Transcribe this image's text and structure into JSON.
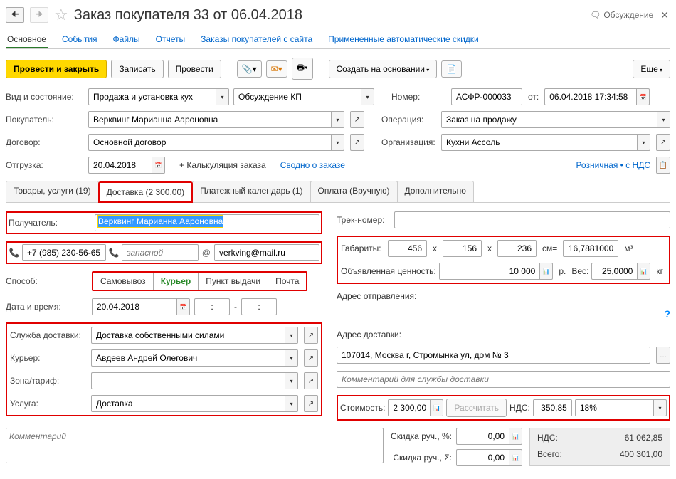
{
  "header": {
    "title": "Заказ покупателя 33 от 06.04.2018",
    "discussion": "Обсуждение"
  },
  "nav": {
    "main": "Основное",
    "events": "События",
    "files": "Файлы",
    "reports": "Отчеты",
    "site_orders": "Заказы покупателей с сайта",
    "auto_discounts": "Примененные автоматические скидки"
  },
  "toolbar": {
    "post_close": "Провести и закрыть",
    "write": "Записать",
    "post": "Провести",
    "create_based": "Создать на основании",
    "more": "Еще"
  },
  "main_form": {
    "kind_label": "Вид и состояние:",
    "kind_value": "Продажа и установка кух",
    "state_value": "Обсуждение КП",
    "number_label": "Номер:",
    "number_value": "АСФР-000033",
    "from_label": "от:",
    "date_value": "06.04.2018 17:34:58",
    "buyer_label": "Покупатель:",
    "buyer_value": "Верквинг Марианна Аароновна",
    "operation_label": "Операция:",
    "operation_value": "Заказ на продажу",
    "contract_label": "Договор:",
    "contract_value": "Основной договор",
    "org_label": "Организация:",
    "org_value": "Кухни Ассоль",
    "shipment_label": "Отгрузка:",
    "shipment_value": "20.04.2018",
    "calc_label": "+ Калькуляция заказа",
    "summary_link": "Сводно о заказе",
    "retail_vat": "Розничная • с НДС"
  },
  "doc_tabs": {
    "goods": "Товары, услуги (19)",
    "delivery": "Доставка (2 300,00)",
    "payment_cal": "Платежный календарь (1)",
    "payment": "Оплата (Вручную)",
    "extra": "Дополнительно"
  },
  "delivery": {
    "recipient_label": "Получатель:",
    "recipient_value": "Верквинг Марианна Аароновна",
    "phone1": "+7 (985) 230-56-65",
    "phone2_ph": "запасной",
    "email": "verkving@mail.ru",
    "method_label": "Способ:",
    "seg_pickup": "Самовывоз",
    "seg_courier": "Курьер",
    "seg_point": "Пункт выдачи",
    "seg_post": "Почта",
    "datetime_label": "Дата и время:",
    "date_value": "20.04.2018",
    "time_sep": "-",
    "time1": ":",
    "time2": ":",
    "service_label": "Служба доставки:",
    "service_value": "Доставка собственными силами",
    "courier_label": "Курьер:",
    "courier_value": "Авдеев Андрей Олегович",
    "zone_label": "Зона/тариф:",
    "zone_value": "",
    "item_label": "Услуга:",
    "item_value": "Доставка",
    "track_label": "Трек-номер:",
    "track_value": "",
    "dims_label": "Габариты:",
    "dim_w": "456",
    "dim_h": "156",
    "dim_d": "236",
    "dim_unit": "см=",
    "dim_vol": "16,7881000",
    "vol_unit": "м³",
    "decl_val_label": "Объявленная ценность:",
    "decl_val": "10 000",
    "decl_unit": "р.",
    "weight_label": "Вес:",
    "weight_value": "25,0000",
    "weight_unit": "кг",
    "from_addr_label": "Адрес отправления:",
    "to_addr_label": "Адрес доставки:",
    "to_addr_value": "107014, Москва г, Стромынка ул, дом № 3",
    "comment_ph": "Комментарий для службы доставки",
    "cost_label": "Стоимость:",
    "cost_value": "2 300,00",
    "calc_btn": "Рассчитать",
    "vat_label": "НДС:",
    "vat_value": "350,85",
    "vat_rate": "18%"
  },
  "footer": {
    "comment_ph": "Комментарий",
    "disc_pct_label": "Скидка руч., %:",
    "disc_pct_val": "0,00",
    "disc_sum_label": "Скидка руч., Σ:",
    "disc_sum_val": "0,00",
    "vat_label": "НДС:",
    "vat_val": "61 062,85",
    "total_label": "Всего:",
    "total_val": "400 301,00"
  }
}
